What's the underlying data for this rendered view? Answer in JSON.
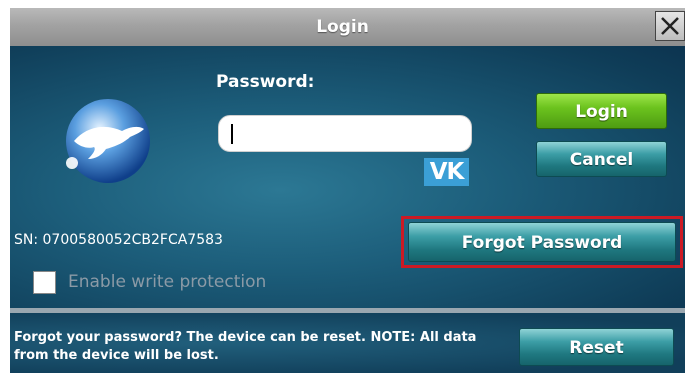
{
  "window": {
    "title": "Login"
  },
  "login_form": {
    "password_label": "Password:",
    "password_value": "",
    "keyboard_badge": "VK"
  },
  "buttons": {
    "login": "Login",
    "cancel": "Cancel",
    "forgot_password": "Forgot Password",
    "reset": "Reset"
  },
  "device": {
    "serial": "SN: 0700580052CB2FCA7583"
  },
  "options": {
    "write_protection_label": "Enable write protection",
    "write_protection_checked": false
  },
  "footer": {
    "reset_note": "Forgot your password? The device can be reset. NOTE: All data from the device will be lost."
  },
  "colors": {
    "highlight": "#cc1a24",
    "login_button": "#6cc31e",
    "teal_button": "#1f7880",
    "vk_badge": "#3b9fd6"
  },
  "icons": {
    "logo": "greyhound-globe-icon",
    "close": "close-icon"
  }
}
